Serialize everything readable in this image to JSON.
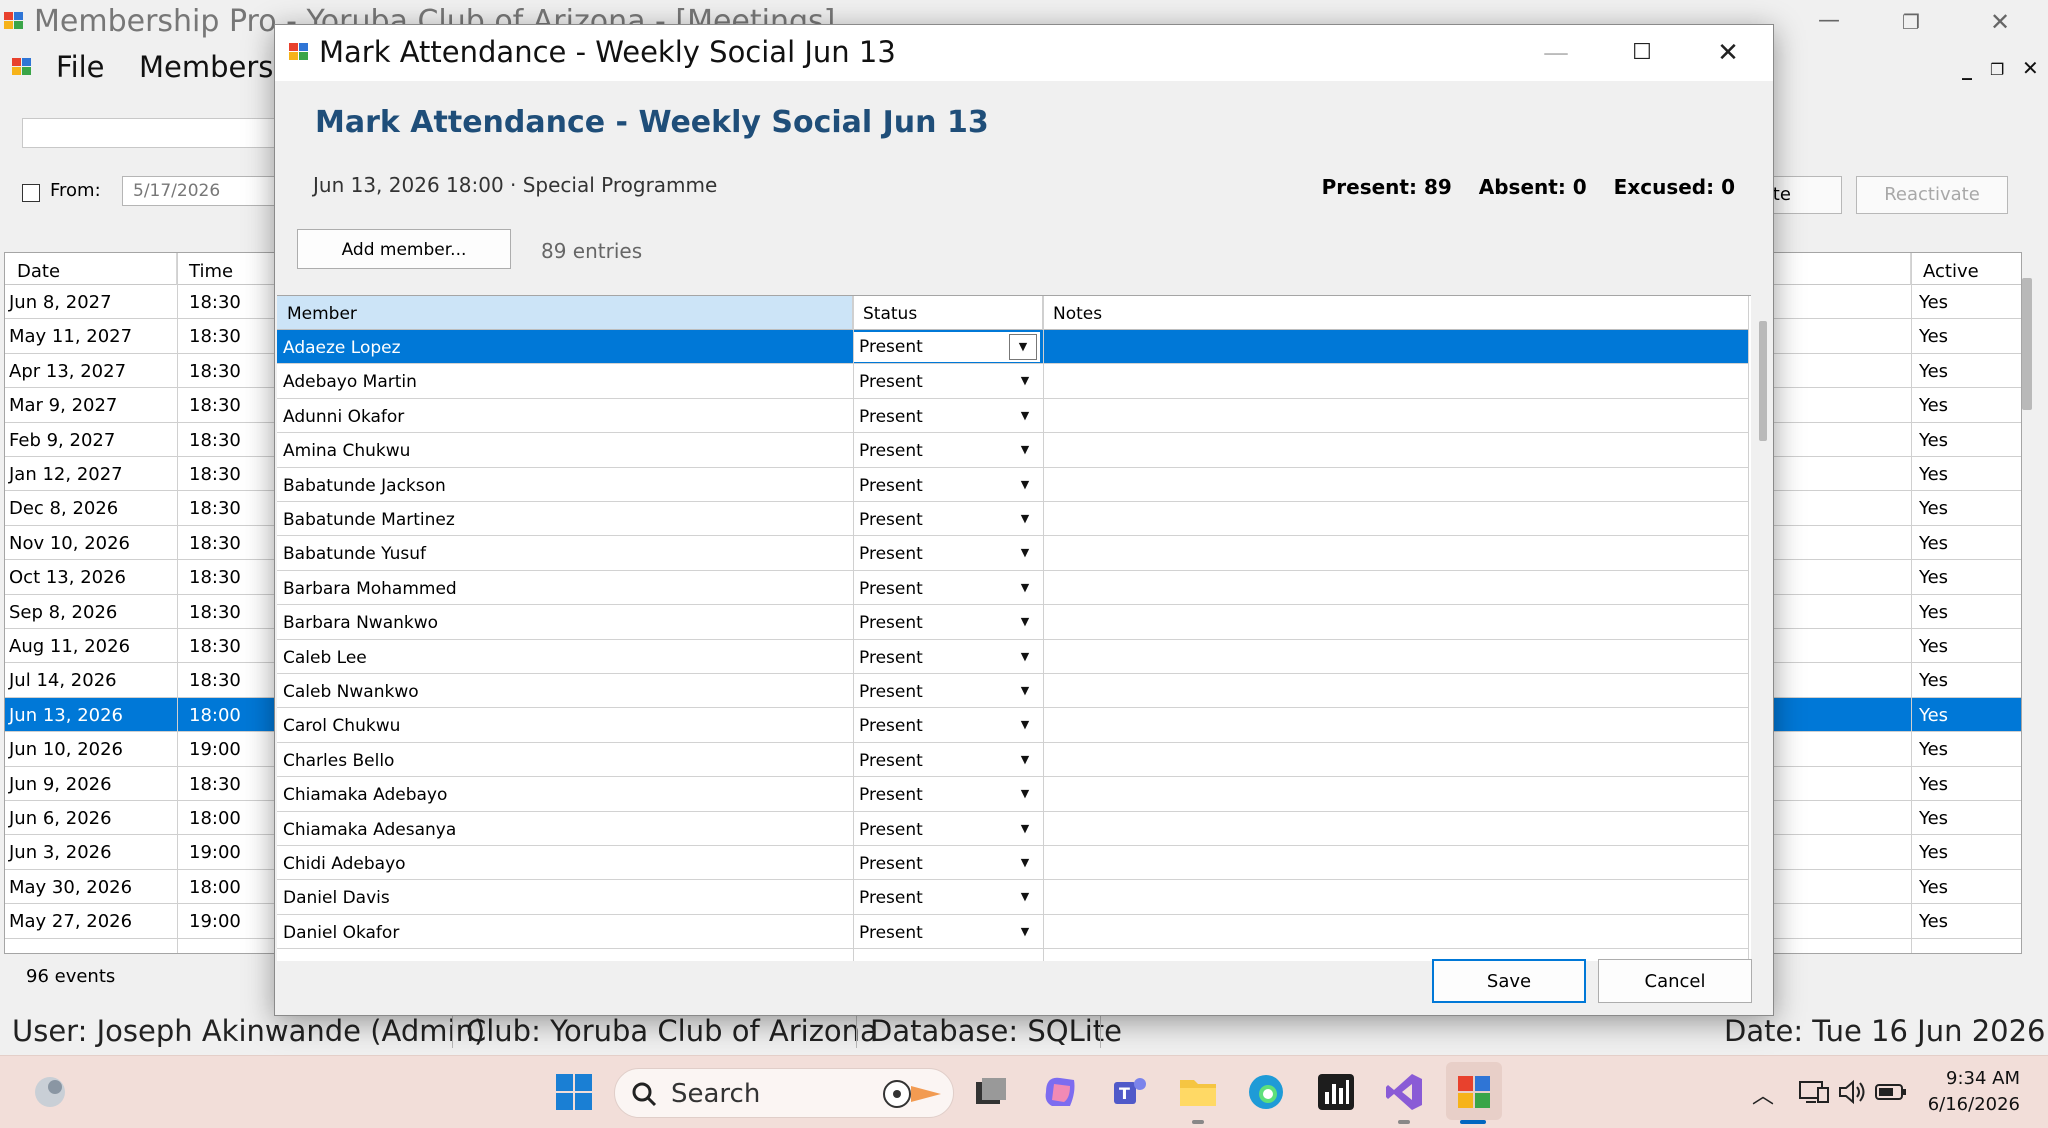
{
  "main_window": {
    "title": "Membership Pro  -  Yoruba Club of Arizona - [Meetings]",
    "menu": [
      "File",
      "Members"
    ],
    "filter": {
      "from_label": "From:",
      "from_value": "5/17/2026"
    },
    "buttons": {
      "deactivate": "vate",
      "reactivate": "Reactivate"
    },
    "columns": {
      "date": "Date",
      "time": "Time",
      "active": "Active"
    },
    "events": [
      {
        "date": "Jun 8, 2027",
        "time": "18:30",
        "active": "Yes"
      },
      {
        "date": "May 11, 2027",
        "time": "18:30",
        "active": "Yes"
      },
      {
        "date": "Apr 13, 2027",
        "time": "18:30",
        "active": "Yes"
      },
      {
        "date": "Mar 9, 2027",
        "time": "18:30",
        "active": "Yes"
      },
      {
        "date": "Feb 9, 2027",
        "time": "18:30",
        "active": "Yes"
      },
      {
        "date": "Jan 12, 2027",
        "time": "18:30",
        "active": "Yes"
      },
      {
        "date": "Dec 8, 2026",
        "time": "18:30",
        "active": "Yes"
      },
      {
        "date": "Nov 10, 2026",
        "time": "18:30",
        "active": "Yes"
      },
      {
        "date": "Oct 13, 2026",
        "time": "18:30",
        "active": "Yes"
      },
      {
        "date": "Sep 8, 2026",
        "time": "18:30",
        "active": "Yes"
      },
      {
        "date": "Aug 11, 2026",
        "time": "18:30",
        "active": "Yes"
      },
      {
        "date": "Jul 14, 2026",
        "time": "18:30",
        "active": "Yes"
      },
      {
        "date": "Jun 13, 2026",
        "time": "18:00",
        "active": "Yes"
      },
      {
        "date": "Jun 10, 2026",
        "time": "19:00",
        "active": "Yes"
      },
      {
        "date": "Jun 9, 2026",
        "time": "18:30",
        "active": "Yes"
      },
      {
        "date": "Jun 6, 2026",
        "time": "18:00",
        "active": "Yes"
      },
      {
        "date": "Jun 3, 2026",
        "time": "19:00",
        "active": "Yes"
      },
      {
        "date": "May 30, 2026",
        "time": "18:00",
        "active": "Yes"
      },
      {
        "date": "May 27, 2026",
        "time": "19:00",
        "active": "Yes"
      }
    ],
    "events_count": "96 events"
  },
  "status_bar": {
    "user": "User: Joseph Akinwande (Admin)",
    "club": "Club: Yoruba Club of Arizona",
    "database": "Database: SQLite",
    "date": "Date: Tue  16 Jun 2026"
  },
  "dialog": {
    "title": "Mark Attendance - Weekly Social Jun 13",
    "heading": "Mark Attendance - Weekly Social Jun 13",
    "subtitle": "Jun 13, 2026 18:00  ·  Special Programme",
    "counts": {
      "present": "Present: 89",
      "absent": "Absent: 0",
      "excused": "Excused: 0"
    },
    "add_member_label": "Add member...",
    "entries_label": "89 entries",
    "columns": {
      "member": "Member",
      "status": "Status",
      "notes": "Notes"
    },
    "rows": [
      {
        "member": "Adaeze Lopez",
        "status": "Present",
        "notes": ""
      },
      {
        "member": "Adebayo Martin",
        "status": "Present",
        "notes": ""
      },
      {
        "member": "Adunni Okafor",
        "status": "Present",
        "notes": ""
      },
      {
        "member": "Amina Chukwu",
        "status": "Present",
        "notes": ""
      },
      {
        "member": "Babatunde Jackson",
        "status": "Present",
        "notes": ""
      },
      {
        "member": "Babatunde Martinez",
        "status": "Present",
        "notes": ""
      },
      {
        "member": "Babatunde Yusuf",
        "status": "Present",
        "notes": ""
      },
      {
        "member": "Barbara Mohammed",
        "status": "Present",
        "notes": ""
      },
      {
        "member": "Barbara Nwankwo",
        "status": "Present",
        "notes": ""
      },
      {
        "member": "Caleb Lee",
        "status": "Present",
        "notes": ""
      },
      {
        "member": "Caleb Nwankwo",
        "status": "Present",
        "notes": ""
      },
      {
        "member": "Carol Chukwu",
        "status": "Present",
        "notes": ""
      },
      {
        "member": "Charles Bello",
        "status": "Present",
        "notes": ""
      },
      {
        "member": "Chiamaka Adebayo",
        "status": "Present",
        "notes": ""
      },
      {
        "member": "Chiamaka Adesanya",
        "status": "Present",
        "notes": ""
      },
      {
        "member": "Chidi Adebayo",
        "status": "Present",
        "notes": ""
      },
      {
        "member": "Daniel Davis",
        "status": "Present",
        "notes": ""
      },
      {
        "member": "Daniel Okafor",
        "status": "Present",
        "notes": ""
      }
    ],
    "save_label": "Save",
    "cancel_label": "Cancel"
  },
  "taskbar": {
    "search_label": "Search",
    "time": "9:34 AM",
    "date": "6/16/2026"
  },
  "colors": {
    "selection": "#0078d7",
    "heading": "#1f4e79",
    "header_highlight": "#cce4f7",
    "taskbar": "#f2ded9"
  }
}
